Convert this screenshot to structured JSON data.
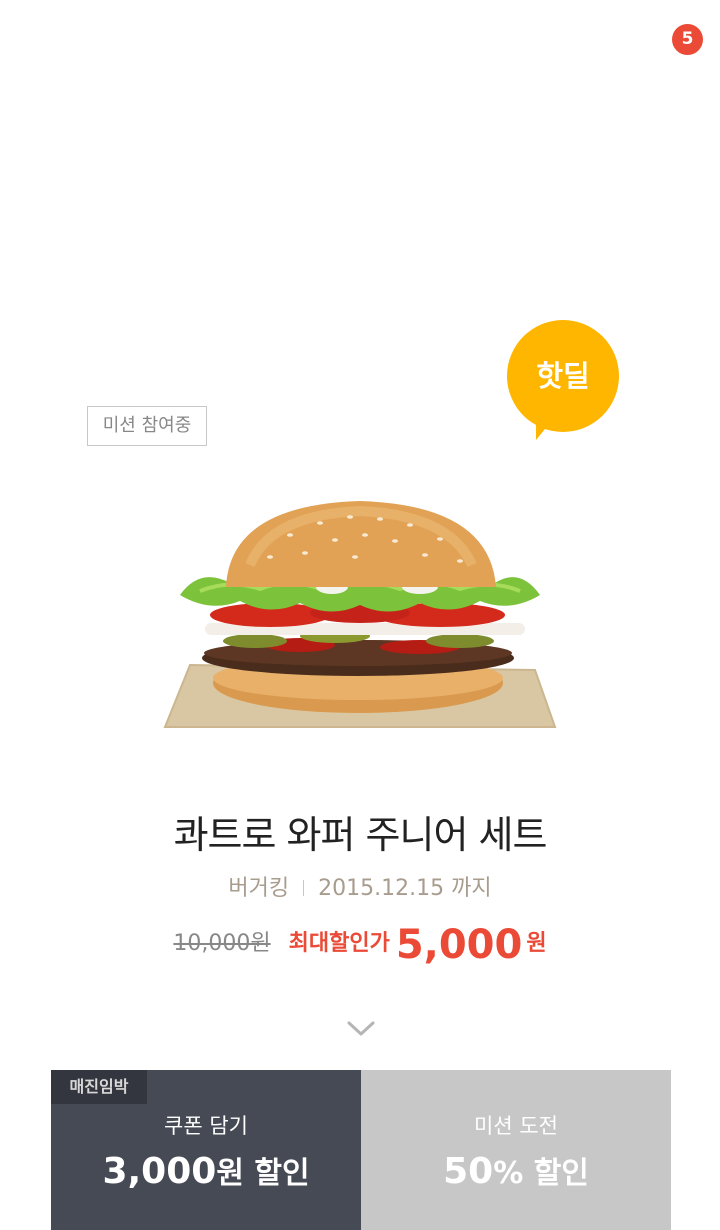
{
  "notification": {
    "count": "5"
  },
  "hot_badge": {
    "label": "핫딜"
  },
  "mission_tag": {
    "label": "미션 참여중"
  },
  "product": {
    "title": "콰트로 와퍼 주니어 세트",
    "brand": "버거킹",
    "until": "2015.12.15 까지",
    "original_price": "10,000원",
    "max_discount_label": "최대할인가",
    "sale_price": "5,000",
    "sale_unit": "원"
  },
  "panels": {
    "coupon": {
      "badge": "매진임박",
      "label": "쿠폰 담기",
      "amount": "3,000",
      "unit": "원 할인"
    },
    "mission": {
      "label": "미션 도전",
      "amount": "50",
      "unit": "% 할인"
    }
  },
  "colors": {
    "accent_red": "#ea4a36",
    "hot_yellow": "#ffb600",
    "coupon_panel": "#464a55",
    "mission_panel": "#c7c7c7"
  }
}
